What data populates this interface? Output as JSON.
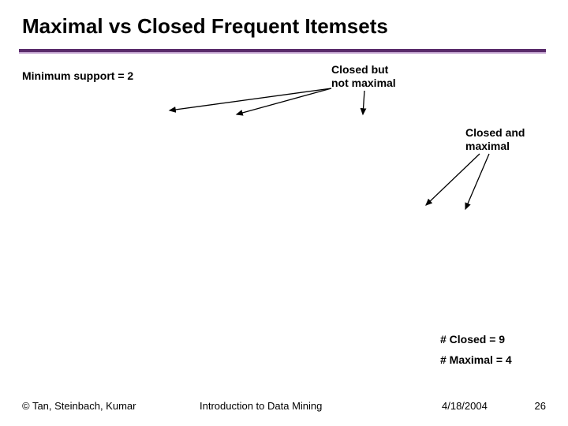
{
  "title": "Maximal vs Closed Frequent Itemsets",
  "minimum_support": "Minimum support = 2",
  "labels": {
    "closed_not_maximal": "Closed but\nnot maximal",
    "closed_and_maximal": "Closed and\nmaximal"
  },
  "counts": {
    "closed": "# Closed = 9",
    "maximal": "# Maximal = 4"
  },
  "footer": {
    "authors": "© Tan, Steinbach, Kumar",
    "course": "Introduction to Data Mining",
    "date": "4/18/2004",
    "page": "26"
  }
}
